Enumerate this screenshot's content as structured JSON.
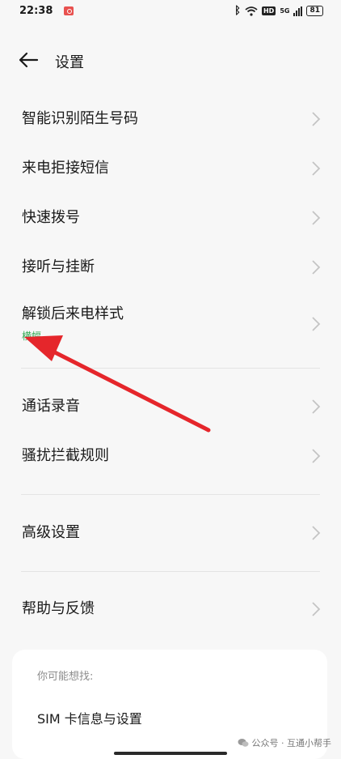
{
  "status_bar": {
    "time": "22:38",
    "hd": "HD",
    "network": "5G",
    "battery": "81"
  },
  "header": {
    "title": "设置"
  },
  "sections": [
    {
      "items": [
        {
          "label": "智能识别陌生号码"
        },
        {
          "label": "来电拒接短信"
        },
        {
          "label": "快速拨号"
        },
        {
          "label": "接听与挂断"
        },
        {
          "label": "解锁后来电样式",
          "sub": "横幅"
        }
      ]
    },
    {
      "items": [
        {
          "label": "通话录音"
        },
        {
          "label": "骚扰拦截规则"
        }
      ]
    },
    {
      "items": [
        {
          "label": "高级设置"
        }
      ]
    },
    {
      "items": [
        {
          "label": "帮助与反馈"
        }
      ]
    }
  ],
  "suggest": {
    "title": "你可能想找:",
    "items": [
      "SIM 卡信息与设置"
    ]
  },
  "watermark": {
    "text": "公众号 · 互通小帮手"
  },
  "colors": {
    "arrow": "#e5262b",
    "accent_green": "#2fa84f",
    "background": "#f7f7f7"
  }
}
